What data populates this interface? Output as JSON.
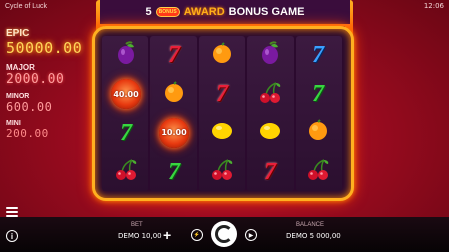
{
  "app": {
    "title": "Cycle of Luck",
    "time": "12:06"
  },
  "banner": {
    "count": "5",
    "bonus_badge": "BONUS",
    "award": "AWARD",
    "rest": "BONUS GAME"
  },
  "jackpots": [
    {
      "name": "EPIC",
      "value": "50000.00"
    },
    {
      "name": "MAJOR",
      "value": "2000.00"
    },
    {
      "name": "MINOR",
      "value": "600.00"
    },
    {
      "name": "MINI",
      "value": "200.00"
    }
  ],
  "reels": [
    [
      "plum",
      "seven-red",
      "orange",
      "plum",
      "seven-blue"
    ],
    [
      "coin",
      "orange",
      "seven-red",
      "cherry",
      "seven-green"
    ],
    [
      "seven-green",
      "coin",
      "lemon",
      "lemon",
      "orange"
    ],
    [
      "cherry",
      "seven-green",
      "cherry",
      "seven-red",
      "cherry"
    ]
  ],
  "coins": {
    "r1c0": "40.00",
    "r2c1": "10.00"
  },
  "bottom": {
    "bet_label": "BET",
    "bet_value": "DEMO 10,00",
    "balance_label": "BALANCE",
    "balance_value": "DEMO 5 000,00"
  }
}
